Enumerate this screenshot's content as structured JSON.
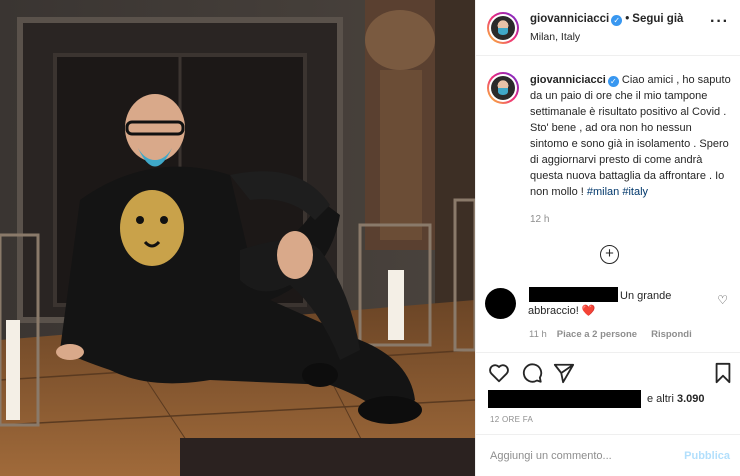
{
  "header": {
    "username": "giovanniciacci",
    "follow_label": "Segui già",
    "location": "Milan, Italy",
    "more_label": "···"
  },
  "caption": {
    "username": "giovanniciacci",
    "text": "Ciao amici , ho saputo da un paio di ore che il mio tampone settimanale è risultato positivo al Covid . Sto' bene , ad ora non ho nessun sintomo e sono già in isolamento . Spero di aggiornarvi presto di come andrà questa nuova battaglia da affrontare . Io non mollo !",
    "hashtags": [
      "#milan",
      "#italy"
    ],
    "time": "12 h"
  },
  "load_more_label": "+",
  "comment": {
    "text": "Un grande abbraccio!",
    "heart": "❤️",
    "time": "11 h",
    "likes": "Piace a 2 persone",
    "reply": "Rispondi"
  },
  "likes": {
    "others_prefix": "e altri",
    "others_count": "3.090"
  },
  "date_label": "12 ORE FA",
  "add_comment": {
    "placeholder": "Aggiungi un commento...",
    "publish": "Pubblica"
  },
  "colors": {
    "link": "#00376b",
    "muted": "#8e8e8e",
    "verified": "#3897f0",
    "publish_disabled": "#b2dffc"
  }
}
